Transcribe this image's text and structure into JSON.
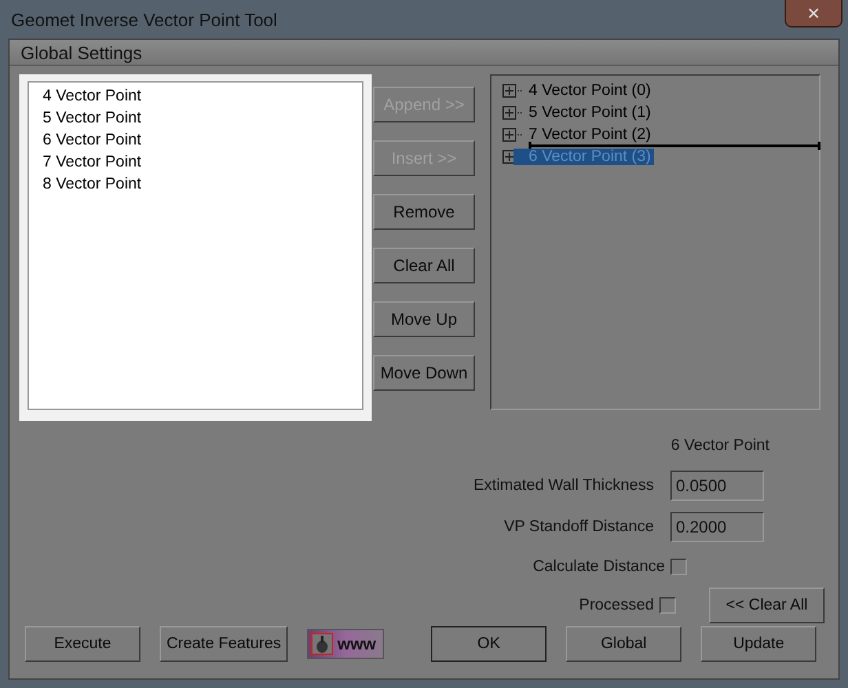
{
  "window": {
    "title": "Geomet Inverse Vector Point Tool",
    "close": "✕"
  },
  "group": {
    "title": "Global Settings"
  },
  "list": {
    "items": [
      "4 Vector Point",
      "5 Vector Point",
      "6 Vector Point",
      "7 Vector Point",
      "8 Vector Point"
    ]
  },
  "side_buttons": [
    {
      "label": "Append >>",
      "disabled": true
    },
    {
      "label": "Insert >>",
      "disabled": true
    },
    {
      "label": "Remove",
      "disabled": false
    },
    {
      "label": "Clear All",
      "disabled": false
    },
    {
      "label": "Move Up",
      "disabled": false
    },
    {
      "label": "Move Down",
      "disabled": false
    }
  ],
  "tree": {
    "items": [
      {
        "label": "4 Vector Point (0)",
        "selected": false,
        "drop_marker_above": false
      },
      {
        "label": "5 Vector Point (1)",
        "selected": false,
        "drop_marker_above": false
      },
      {
        "label": "7 Vector Point (2)",
        "selected": false,
        "drop_marker_above": false
      },
      {
        "label": "6 Vector Point (3)",
        "selected": true,
        "drop_marker_above": true
      }
    ]
  },
  "details": {
    "heading": "6 Vector Point",
    "fields": [
      {
        "label": "Extimated Wall Thickness",
        "value": "0.0500"
      },
      {
        "label": "VP Standoff Distance",
        "value": "0.2000"
      }
    ],
    "checks": [
      {
        "label": "Calculate Distance",
        "checked": false
      },
      {
        "label": "Processed",
        "checked": false
      }
    ],
    "clear_button": "<< Clear All"
  },
  "bottom_buttons": [
    {
      "kind": "text",
      "label": "Execute"
    },
    {
      "kind": "text",
      "label": "Create Features"
    },
    {
      "kind": "web",
      "label": "www"
    },
    {
      "kind": "text",
      "label": "OK"
    },
    {
      "kind": "text",
      "label": "Global"
    },
    {
      "kind": "text",
      "label": "Update"
    }
  ]
}
